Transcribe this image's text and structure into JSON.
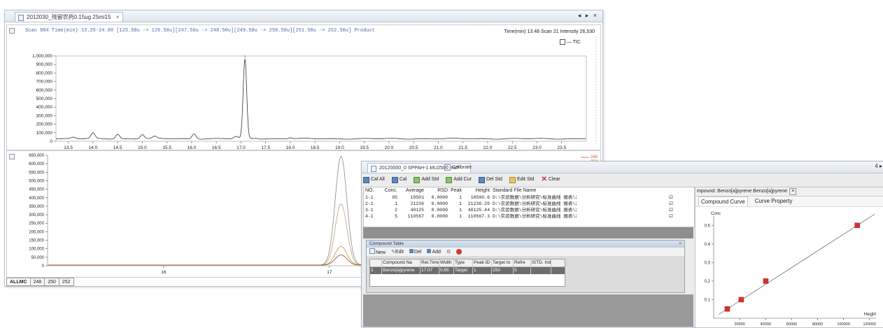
{
  "main": {
    "tab_title": "2012030_残留农药0.15ug 25mi15",
    "win_ctrls": "◂ ▸ ×",
    "scan_info": "Scan 984 Time(min) 13.25-24.00 [125.50u -> 126.50u][247.50u -> 248.50u][249.50u -> 250.50u][251.50u -> 252.50u] Product",
    "time_info": "Time(min) 13.48 Scan 21 Intensity 26,530",
    "tic_label": "— TIC",
    "chart_data": {
      "type": "line",
      "ylim": [
        0,
        1000000
      ],
      "yticks": [
        "1,000,000",
        "900,000",
        "800,000",
        "700,000",
        "600,000",
        "500,000",
        "400,000",
        "300,000",
        "200,000",
        "100,000",
        "0"
      ],
      "xticks": [
        "13.5",
        "14.0",
        "14.5",
        "15.0",
        "15.5",
        "16.0",
        "16.5",
        "17.0",
        "17.5",
        "18.0",
        "18.5",
        "19.0",
        "19.5",
        "20.0",
        "20.5",
        "21.0",
        "21.5",
        "22.0",
        "22.5",
        "23.0",
        "23.5"
      ],
      "xlim": [
        13.25,
        24.0
      ],
      "peak_time": 17.08,
      "peak_height": 960000
    },
    "lower_chart": {
      "type": "line",
      "ylim": [
        0,
        650000
      ],
      "yticks": [
        "650,000",
        "600,000",
        "550,000",
        "500,000",
        "450,000",
        "400,000",
        "350,000",
        "300,000",
        "250,000",
        "200,000",
        "150,000",
        "100,000",
        "50,000",
        "0"
      ],
      "xticks": [
        "16",
        "17",
        "18"
      ],
      "legend": [
        "248",
        "250"
      ]
    },
    "channel_tabs": [
      "ALLMC",
      "248",
      "250",
      "252"
    ]
  },
  "calibrate": {
    "tab_title": "20120000_0 SPPAH-1.MU2500 ms?",
    "tab2_label": "Calibrate",
    "toolbar": [
      "Cal All",
      "Cal",
      "Add Std",
      "Add Cur",
      "Del Std",
      "Edit Std",
      "Clear"
    ],
    "std_headers": [
      "NO.",
      "Conc.",
      "Average",
      "RSD",
      "Peak",
      "Height",
      "Standard File Name"
    ],
    "std_rows": [
      {
        "no": "1-1",
        "conc": "05",
        "avg": "10501",
        "rsd": "0.0000",
        "pk": "1",
        "h": "10500.6",
        "file": "D:\\实验数据\\分析研究\\标准曲线 报表\\20"
      },
      {
        "no": "2-1",
        "conc": "1",
        "avg": "21236",
        "rsd": "0.0000",
        "pk": "1",
        "h": "21236.29",
        "file": "D:\\实验数据\\分析研究\\标准曲线 报表\\20"
      },
      {
        "no": "3-1",
        "conc": "2",
        "avg": "40125",
        "rsd": "0.0000",
        "pk": "1",
        "h": "40125.44",
        "file": "D:\\实验数据\\分析研究\\标准曲线 报表\\20"
      },
      {
        "no": "4-1",
        "conc": "5",
        "avg": "110567",
        "rsd": "0.0000",
        "pk": "1",
        "h": "110567.3",
        "file": "D:\\实验数据\\分析研究\\标准曲线 报表\\20"
      }
    ],
    "compound_table": {
      "title": "Compound Table",
      "toolbar": [
        "New",
        "Edit",
        "Del",
        "Add"
      ],
      "headers": [
        "",
        "Compound Na",
        "Ret.Time",
        "Width",
        "Type",
        "Peak ID",
        "Target Io",
        "Refre",
        "ISTD. Ind"
      ],
      "row": [
        "1",
        "Benzo[a]pyrene",
        "17.07",
        "0.85",
        "Target",
        "1",
        "250",
        "5",
        ""
      ]
    },
    "curve": {
      "panel_title": "mpound: Benzo[a]pyrene Benzo[a]pyrene",
      "tabs": [
        "Compound Curve",
        "Curve Property"
      ],
      "ylabel": "Conc",
      "xlabel": "Height",
      "chart_data": {
        "type": "scatter",
        "xlim": [
          0,
          125000
        ],
        "ylim": [
          0,
          5.5
        ],
        "yticks": [
          "0.1",
          "0.2",
          "0.3",
          "0.4",
          "0.5"
        ],
        "xticks": [
          "20000",
          "40000",
          "60000",
          "80000",
          "100000",
          "120000"
        ],
        "points": [
          [
            10500.6,
            0.5
          ],
          [
            21236.29,
            1
          ],
          [
            40125.44,
            2
          ],
          [
            110567.3,
            5
          ]
        ]
      }
    },
    "edge_mark": "4 ▸"
  }
}
